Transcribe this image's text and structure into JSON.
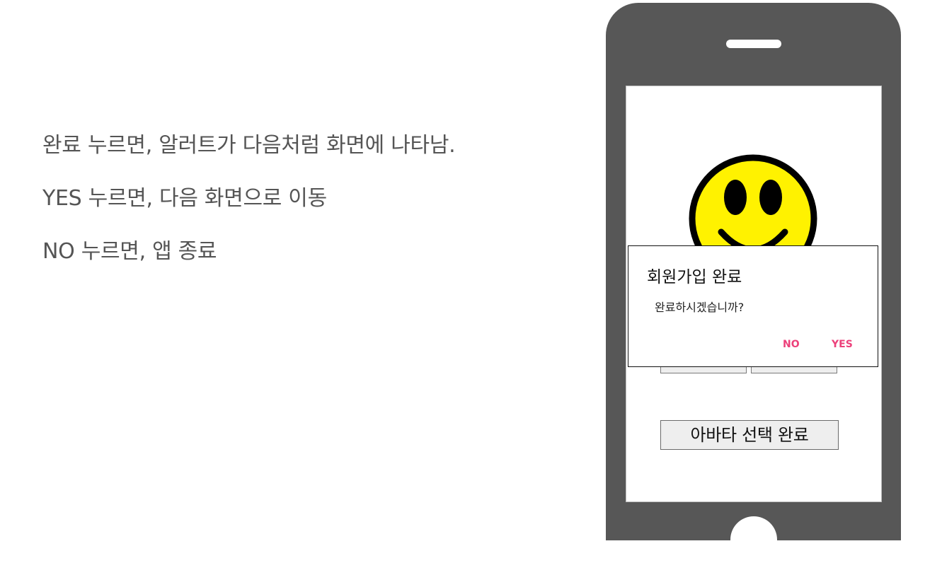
{
  "description": {
    "lines": [
      "완료 누르면, 알러트가 다음처럼 화면에 나타남.",
      "YES 누르면, 다음 화면으로 이동",
      "NO 누르면, 앱 종료"
    ]
  },
  "phone": {
    "complete_button_label": "아바타 선택 완료",
    "smiley_colors": {
      "face": "#fff200",
      "outline": "#000000"
    }
  },
  "dialog": {
    "title": "회원가입 완료",
    "message": "완료하시겠습니까?",
    "negative_label": "NO",
    "positive_label": "YES",
    "accent_color": "#ec407a"
  }
}
